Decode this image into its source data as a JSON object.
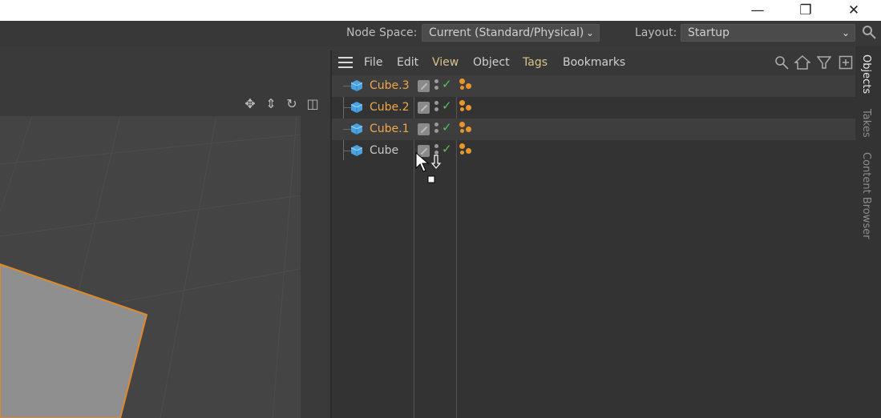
{
  "window": {
    "minimize_glyph": "—",
    "restore_glyph": "❐",
    "close_glyph": "✕"
  },
  "top": {
    "node_space_label": "Node Space:",
    "node_space_value": "Current (Standard/Physical)",
    "layout_label": "Layout:",
    "layout_value": "Startup"
  },
  "object_manager": {
    "menu": [
      "File",
      "Edit",
      "View",
      "Object",
      "Tags",
      "Bookmarks"
    ],
    "objects": [
      {
        "name": "Cube.3",
        "selected": true
      },
      {
        "name": "Cube.2",
        "selected": true
      },
      {
        "name": "Cube.1",
        "selected": true
      },
      {
        "name": "Cube",
        "selected": false
      }
    ]
  },
  "side_tabs": [
    "Objects",
    "Takes",
    "Content Browser"
  ],
  "colors": {
    "selected_text": "#f0a74a",
    "check_green": "#56c35a",
    "tag_orange": "#e8962a",
    "cube_blue": "#4aa3e0"
  },
  "icons": [
    "search-icon",
    "home-icon",
    "filter-icon",
    "add-icon",
    "move-icon",
    "zoom-icon",
    "rotate-icon",
    "frame-icon"
  ]
}
